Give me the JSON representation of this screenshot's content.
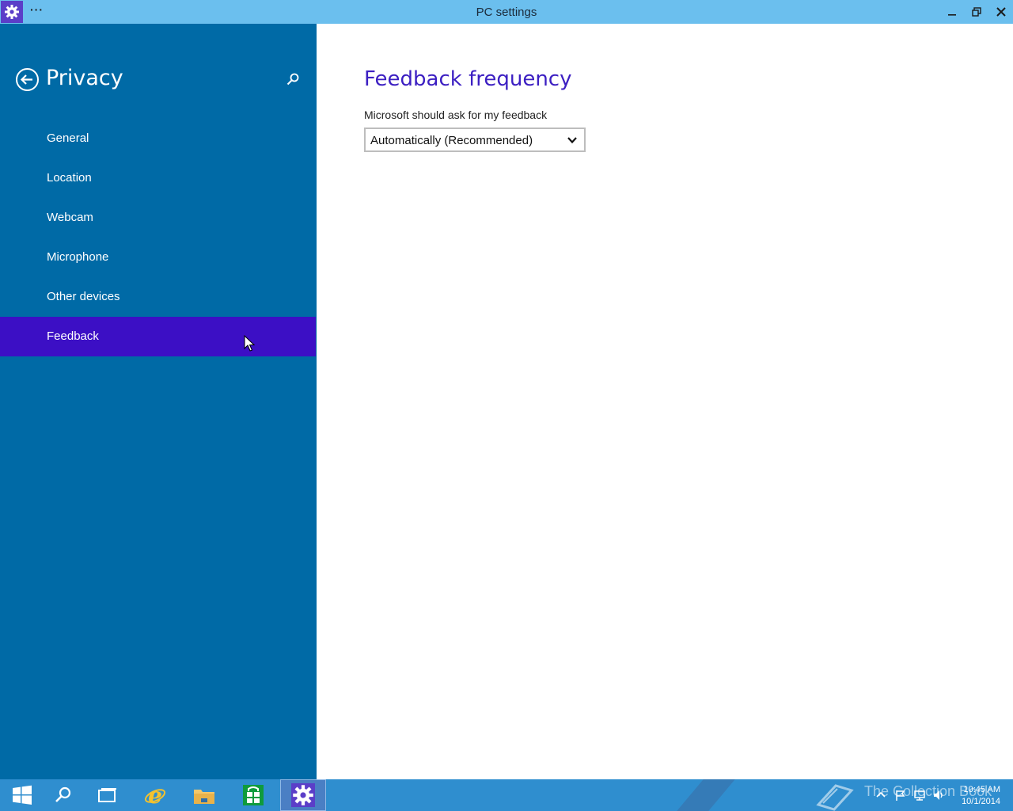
{
  "window": {
    "title": "PC settings",
    "menu_label": "···",
    "accent": "#5b3ec8"
  },
  "sidebar": {
    "title": "Privacy",
    "items": [
      {
        "label": "General"
      },
      {
        "label": "Location"
      },
      {
        "label": "Webcam"
      },
      {
        "label": "Microphone"
      },
      {
        "label": "Other devices"
      },
      {
        "label": "Feedback",
        "selected": true
      }
    ],
    "bg_color": "#006aa6",
    "selected_color": "#3c0fc5"
  },
  "main": {
    "section_title": "Feedback frequency",
    "field_label": "Microsoft should ask for my feedback",
    "dropdown_value": "Automatically (Recommended)",
    "title_color": "#3c1fc2"
  },
  "taskbar": {
    "watermark": "The Collection Book",
    "time": "10:45 AM",
    "date": "10/1/2014",
    "apps": [
      "start-icon",
      "search-icon",
      "task-view-icon",
      "internet-explorer-icon",
      "file-explorer-icon",
      "store-icon",
      "settings-icon"
    ]
  }
}
